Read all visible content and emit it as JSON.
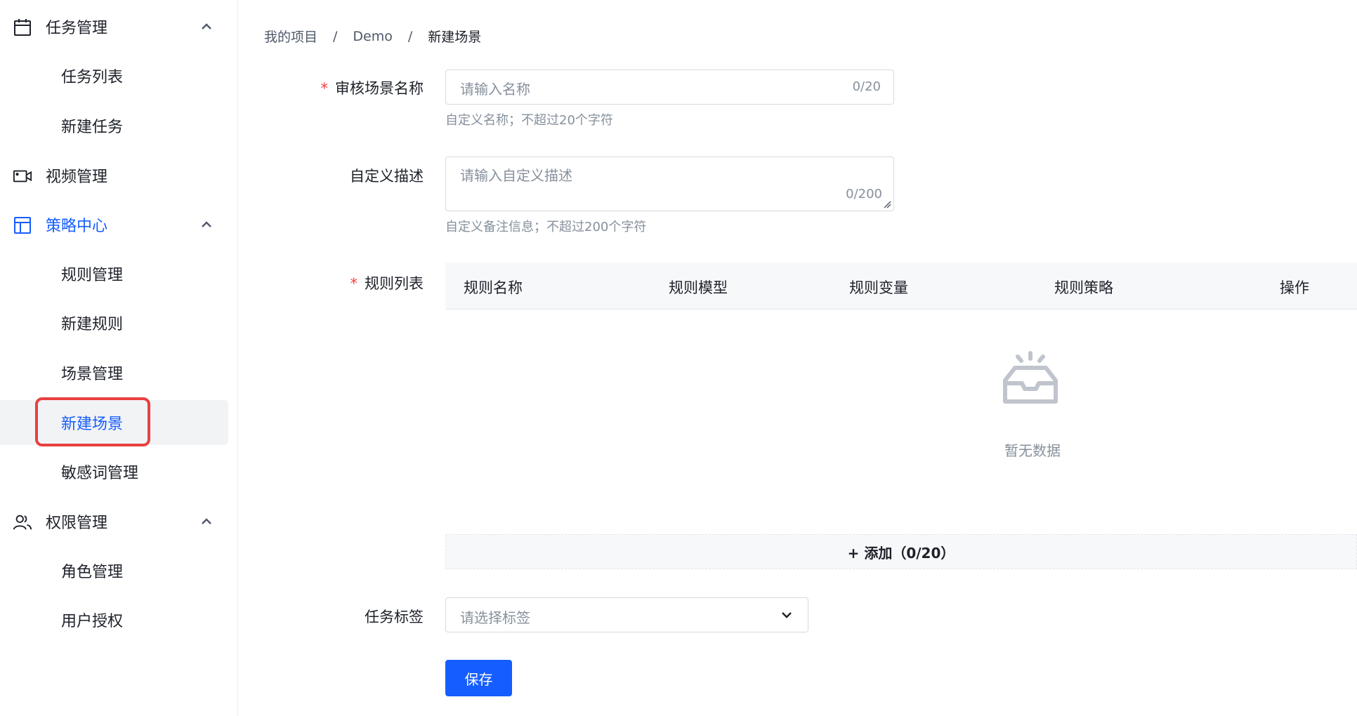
{
  "sidebar": {
    "groups": [
      {
        "label": "任务管理",
        "icon": "calendar-icon",
        "items": [
          {
            "label": "任务列表"
          },
          {
            "label": "新建任务"
          }
        ]
      },
      {
        "label": "视频管理",
        "icon": "video-icon",
        "items": []
      },
      {
        "label": "策略中心",
        "icon": "layout-icon",
        "items": [
          {
            "label": "规则管理"
          },
          {
            "label": "新建规则"
          },
          {
            "label": "场景管理"
          },
          {
            "label": "新建场景"
          },
          {
            "label": "敏感词管理"
          }
        ]
      },
      {
        "label": "权限管理",
        "icon": "users-icon",
        "items": [
          {
            "label": "角色管理"
          },
          {
            "label": "用户授权"
          }
        ]
      }
    ],
    "active_item": "新建场景"
  },
  "breadcrumb": {
    "items": [
      "我的项目",
      "Demo",
      "新建场景"
    ],
    "separator": "/"
  },
  "form": {
    "name": {
      "label": "审核场景名称",
      "required_mark": "*",
      "placeholder": "请输入名称",
      "counter": "0/20",
      "help": "自定义名称；不超过20个字符"
    },
    "description": {
      "label": "自定义描述",
      "placeholder": "请输入自定义描述",
      "counter": "0/200",
      "help": "自定义备注信息；不超过200个字符"
    },
    "rules": {
      "label": "规则列表",
      "required_mark": "*",
      "columns": [
        "规则名称",
        "规则模型",
        "规则变量",
        "规则策略",
        "操作"
      ],
      "empty_text": "暂无数据",
      "add_label": "+ 添加（0/20）"
    },
    "tags": {
      "label": "任务标签",
      "placeholder": "请选择标签"
    },
    "save_label": "保存"
  },
  "colors": {
    "primary": "#165dff",
    "required": "#f53f3f",
    "highlight_box": "#e84040"
  }
}
